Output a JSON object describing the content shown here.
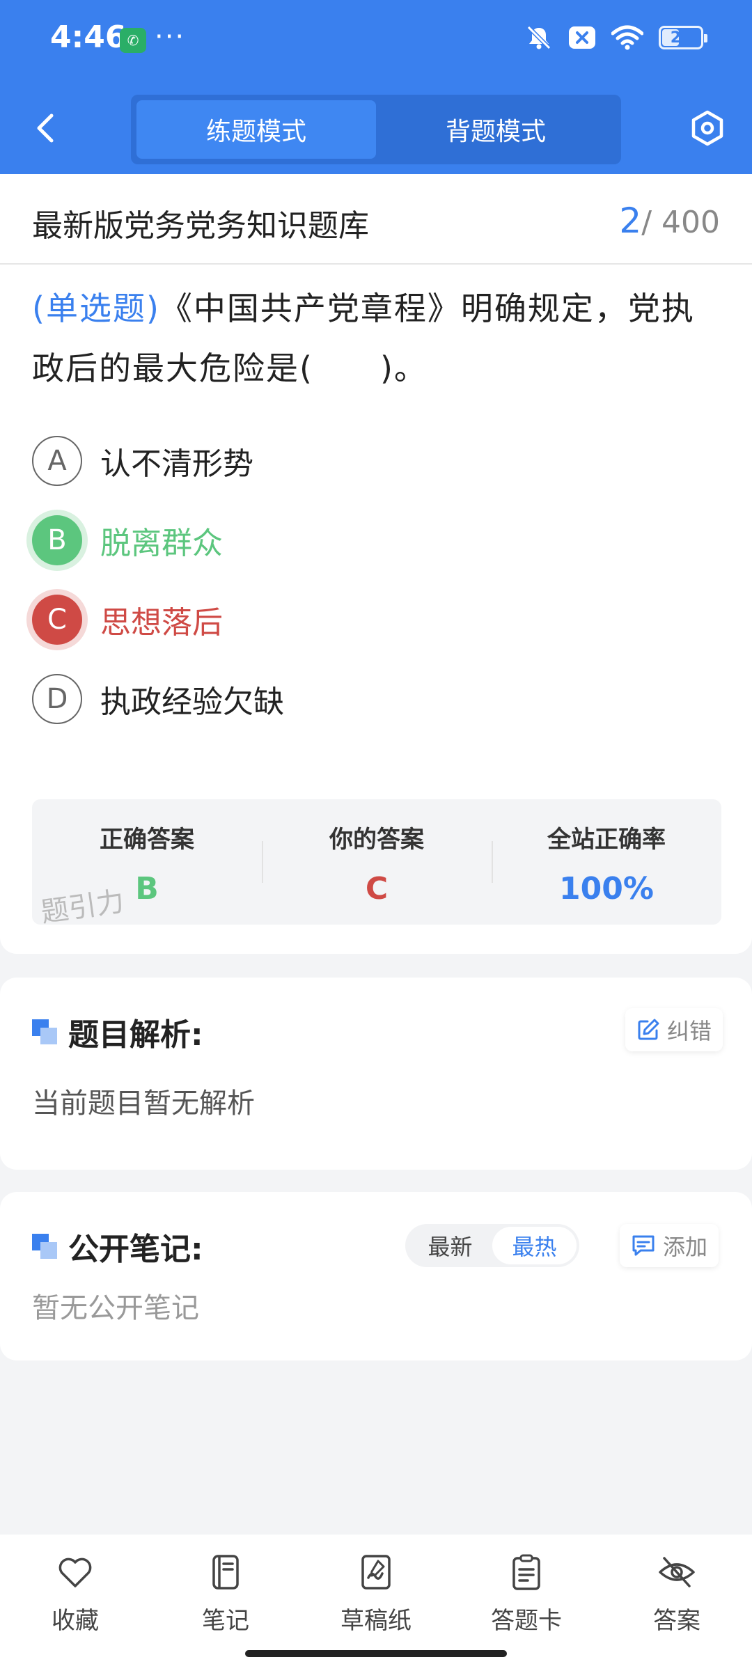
{
  "status_bar": {
    "time": "4:46",
    "more": "···",
    "battery": "21",
    "icons": [
      "wechat-icon",
      "mute-icon",
      "close-badge-icon",
      "wifi-icon",
      "battery-icon"
    ]
  },
  "header": {
    "modes": [
      {
        "label": "练题模式",
        "active": true
      },
      {
        "label": "背题模式",
        "active": false
      }
    ],
    "back_icon": "chevron-left-icon",
    "settings_icon": "hexagon-settings-icon"
  },
  "question_bank": {
    "title": "最新版党务党务知识题库",
    "current": "2",
    "total": "/ 400"
  },
  "question": {
    "type": "(单选题)",
    "text": "《中国共产党章程》明确规定，党执政后的最大危险是(　　)。",
    "options": [
      {
        "letter": "A",
        "text": "认不清形势",
        "state": "normal"
      },
      {
        "letter": "B",
        "text": "脱离群众",
        "state": "correct"
      },
      {
        "letter": "C",
        "text": "思想落后",
        "state": "wrong"
      },
      {
        "letter": "D",
        "text": "执政经验欠缺",
        "state": "normal"
      }
    ]
  },
  "answer_summary": {
    "correct_label": "正确答案",
    "correct_value": "B",
    "yours_label": "你的答案",
    "yours_value": "C",
    "rate_label": "全站正确率",
    "rate_value": "100%",
    "watermark": "题引力"
  },
  "analysis": {
    "title": "题目解析:",
    "report_label": "纠错",
    "content": "当前题目暂无解析"
  },
  "notes": {
    "title": "公开笔记:",
    "sort_options": [
      {
        "label": "最新",
        "active": false
      },
      {
        "label": "最热",
        "active": true
      }
    ],
    "add_label": "添加",
    "empty_text": "暂无公开笔记"
  },
  "bottom_nav": [
    {
      "label": "收藏",
      "icon": "heart-icon"
    },
    {
      "label": "笔记",
      "icon": "notebook-icon"
    },
    {
      "label": "草稿纸",
      "icon": "draft-paper-icon"
    },
    {
      "label": "答题卡",
      "icon": "answer-sheet-icon"
    },
    {
      "label": "答案",
      "icon": "eye-off-icon"
    }
  ],
  "colors": {
    "primary": "#3a80ee",
    "correct": "#5cc67e",
    "wrong": "#cf4a45",
    "background": "#f3f4f6"
  }
}
